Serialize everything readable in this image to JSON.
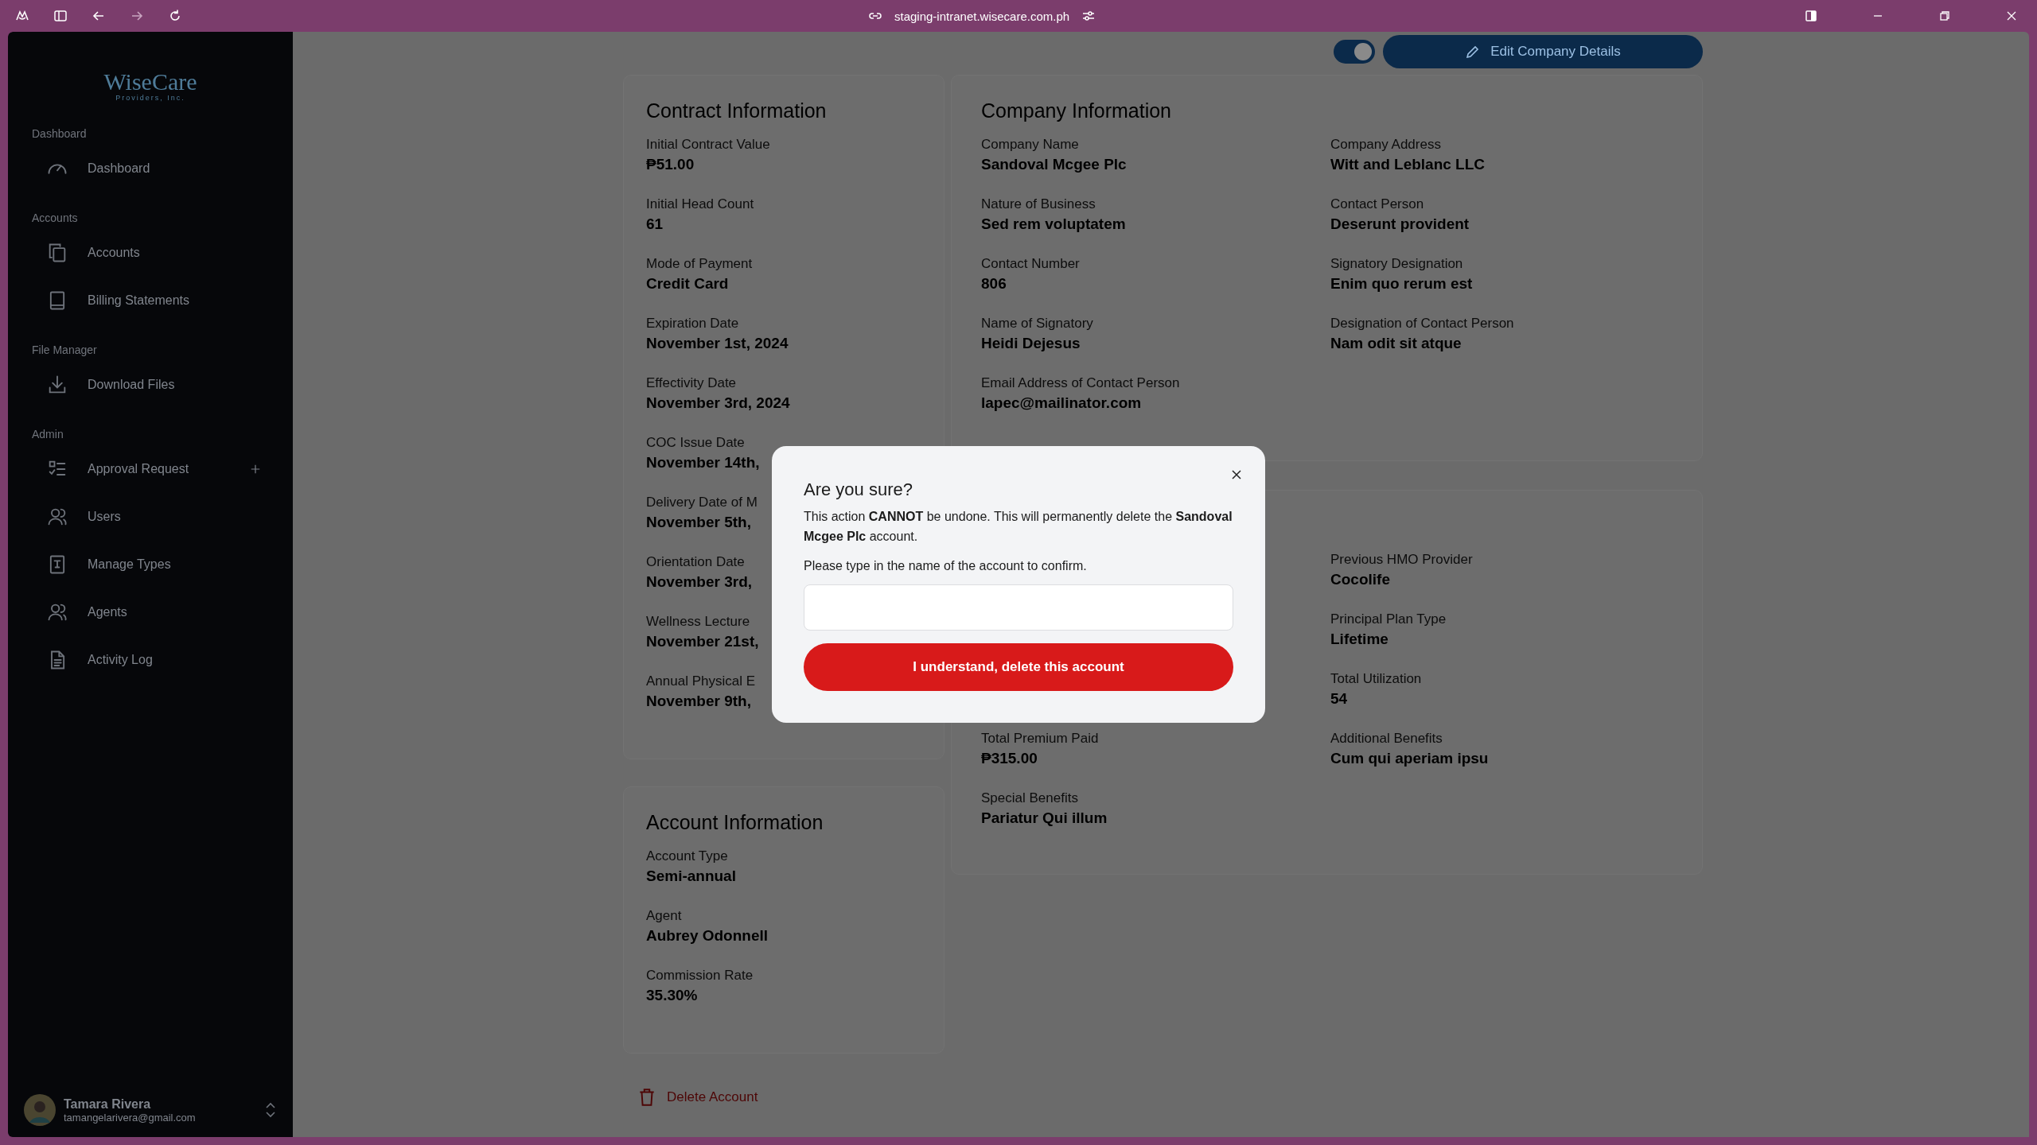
{
  "browser": {
    "url": "staging-intranet.wisecare.com.ph"
  },
  "sidebar": {
    "logo": {
      "name": "WiseCare",
      "tagline": "Providers, Inc."
    },
    "sections": [
      {
        "title": "Dashboard",
        "items": [
          {
            "label": "Dashboard",
            "kind": "gauge",
            "has_add": false
          }
        ]
      },
      {
        "title": "Accounts",
        "items": [
          {
            "label": "Accounts",
            "kind": "copy",
            "has_add": false
          },
          {
            "label": "Billing Statements",
            "kind": "book",
            "has_add": false
          }
        ]
      },
      {
        "title": "File Manager",
        "items": [
          {
            "label": "Download Files",
            "kind": "download",
            "has_add": false
          }
        ]
      },
      {
        "title": "Admin",
        "items": [
          {
            "label": "Approval Request",
            "kind": "checklist",
            "has_add": true
          },
          {
            "label": "Users",
            "kind": "users",
            "has_add": false
          },
          {
            "label": "Manage Types",
            "kind": "type",
            "has_add": false
          },
          {
            "label": "Agents",
            "kind": "users",
            "has_add": false
          },
          {
            "label": "Activity Log",
            "kind": "file",
            "has_add": false
          }
        ]
      }
    ],
    "user": {
      "name": "Tamara Rivera",
      "email": "tamangelarivera@gmail.com"
    }
  },
  "toolbar": {
    "toggle": {
      "on": true
    },
    "edit_button": "Edit Company Details"
  },
  "contract_card": {
    "title": "Contract Information",
    "fields": [
      {
        "label": "Initial Contract Value",
        "value": "₱51.00"
      },
      {
        "label": "Initial Head Count",
        "value": "61"
      },
      {
        "label": "Mode of Payment",
        "value": "Credit Card"
      },
      {
        "label": "Expiration Date",
        "value": "November 1st, 2024"
      },
      {
        "label": "Effectivity Date",
        "value": "November 3rd, 2024"
      },
      {
        "label": "COC Issue Date",
        "value": "November 14th,"
      },
      {
        "label": "Delivery Date of M",
        "value": "November 5th,"
      },
      {
        "label": "Orientation Date",
        "value": "November 3rd,"
      },
      {
        "label": "Wellness Lecture",
        "value": "November 21st,"
      },
      {
        "label": "Annual Physical E",
        "value": "November 9th,"
      }
    ]
  },
  "company_card": {
    "title": "Company Information",
    "columns": [
      [
        {
          "label": "Company Name",
          "value": "Sandoval Mcgee Plc"
        },
        {
          "label": "Nature of Business",
          "value": "Sed rem voluptatem"
        },
        {
          "label": "Contact Number",
          "value": "806"
        },
        {
          "label": "Name of Signatory",
          "value": "Heidi Dejesus"
        },
        {
          "label": "Email Address of Contact Person",
          "value": "lapec@mailinator.com"
        }
      ],
      [
        {
          "label": "Company Address",
          "value": "Witt and Leblanc LLC"
        },
        {
          "label": "Contact Person",
          "value": "Deserunt provident"
        },
        {
          "label": "Signatory Designation",
          "value": "Enim quo rerum est"
        },
        {
          "label": "Designation of Contact Person",
          "value": "Nam odit sit atque"
        }
      ]
    ]
  },
  "plan_card": {
    "columns": [
      [
        {
          "label": "Total Premium Paid",
          "value": "₱315.00"
        },
        {
          "label": "Special Benefits",
          "value": "Pariatur Qui illum"
        }
      ],
      [
        {
          "label": "Previous HMO Provider",
          "value": "Cocolife"
        },
        {
          "label": "Principal Plan Type",
          "value": "Lifetime"
        },
        {
          "label": "Total Utilization",
          "value": "54"
        },
        {
          "label": "Additional Benefits",
          "value": "Cum qui aperiam ipsu"
        }
      ]
    ]
  },
  "account_card": {
    "title": "Account Information",
    "fields": [
      {
        "label": "Account Type",
        "value": "Semi-annual"
      },
      {
        "label": "Agent",
        "value": "Aubrey Odonnell"
      },
      {
        "label": "Commission Rate",
        "value": "35.30%"
      }
    ]
  },
  "delete_link": "Delete Account",
  "modal": {
    "title": "Are you sure?",
    "message": "This action **CANNOT** be undone. This will permanently delete the **Sandoval Mcgee Plc** account.",
    "prompt": "Please type in the name of the account to confirm.",
    "confirm_button": "I understand, delete this account"
  }
}
